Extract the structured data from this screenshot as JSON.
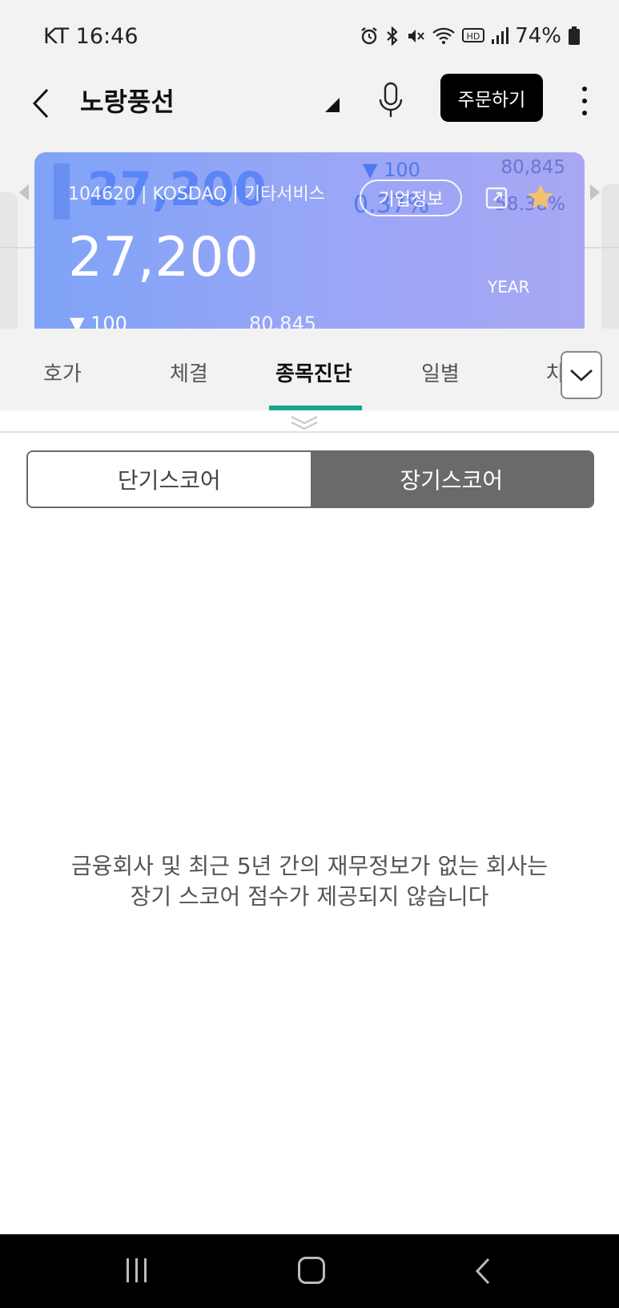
{
  "status_bar": {
    "carrier_time": "KT 16:46",
    "battery": "74%",
    "icons": [
      "alarm-icon",
      "bluetooth-icon",
      "mute-icon",
      "wifi-icon",
      "hd-icon",
      "signal-icon",
      "battery-icon"
    ]
  },
  "header": {
    "title": "노랑풍선",
    "order_label": "주문하기"
  },
  "card": {
    "ghost_price": "27,200",
    "code_line": "104620 | KOSDAQ | 기타서비스",
    "ghost_change": "▼ 100",
    "ghost_rate": "0.37%",
    "company_info": "기업정보",
    "ghost_volume": "80,845",
    "ghost_volume_pct": "58.38%",
    "price": "27,200",
    "year_label": "YEAR",
    "change": "▼ 100",
    "volume": "80,845",
    "accent": "#17a58b"
  },
  "tabs": [
    {
      "label": "호가"
    },
    {
      "label": "체결"
    },
    {
      "label": "종목진단"
    },
    {
      "label": "일별"
    },
    {
      "label": "차"
    }
  ],
  "score": {
    "short_label": "단기스코어",
    "long_label": "장기스코어",
    "message_line1": "금융회사 및 최근 5년 간의 재무정보가 없는 회사는",
    "message_line2": "장기 스코어 점수가 제공되지 않습니다"
  }
}
